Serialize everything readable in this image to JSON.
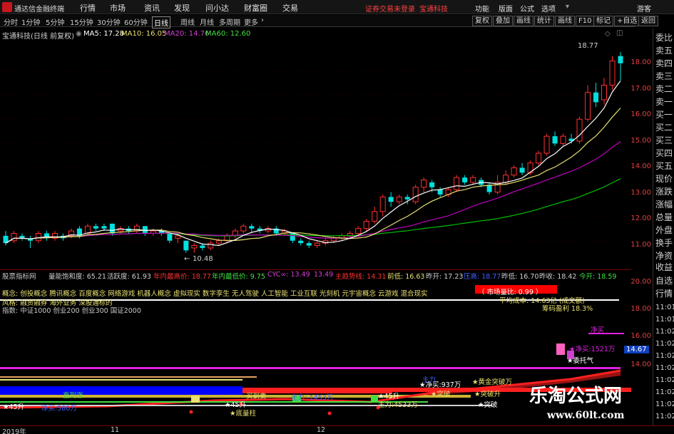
{
  "titlebar": {
    "app_title": "通达信金融终端",
    "menus": [
      "行情",
      "市场",
      "资讯",
      "发现",
      "问小达",
      "财富圈",
      "交易"
    ],
    "alert_login": "证券交易未登录",
    "alert_stock": "宝通科技",
    "right_menus": [
      "功能",
      "版面",
      "公式",
      "选项"
    ],
    "guest": "游客"
  },
  "periods": [
    "分时",
    "1分钟",
    "5分钟",
    "15分钟",
    "30分钟",
    "60分钟",
    "日线",
    "周线",
    "月线",
    "多周期",
    "更多"
  ],
  "active_period": "日线",
  "right_buttons": [
    "复权",
    "叠加",
    "画线",
    "统计",
    "画线",
    "F10",
    "标记",
    "+自选",
    "返回"
  ],
  "chart_header": {
    "stock": "宝通科技(日线 前复权)",
    "ma5": "MA5: 17.28",
    "ma10": "MA10: 16.05",
    "ma20": "MA20: 14.76",
    "ma60": "MA60: 12.60"
  },
  "price_axis": [
    "18.00",
    "17.00",
    "16.00",
    "15.00",
    "14.00",
    "13.00",
    "12.00",
    "11.00"
  ],
  "annotations": {
    "high": "18.77",
    "low": "10.48"
  },
  "right_panel": [
    "委比",
    "卖五",
    "卖四",
    "卖三",
    "卖二",
    "卖一",
    "买一",
    "买二",
    "买三",
    "买四",
    "买五",
    "现价",
    "涨跌",
    "涨幅",
    "总量",
    "外盘",
    "换手",
    "净资",
    "收益"
  ],
  "right_panel2": [
    "自选",
    "行情"
  ],
  "right_times": [
    "11:01",
    "11:01",
    "11:02",
    "11:02",
    "11:02",
    "11:02",
    "11:02",
    "11:02",
    "11:02",
    "11:02"
  ],
  "ind_bar": {
    "name": "股票指标网",
    "sat": "量能饱和度: 65.21",
    "act": "活跃度: 61.93",
    "yhigh": "年内最高价: 18.77",
    "ylow": "年内最低价: 9.75",
    "cyc": "CYC∞: 13.49",
    "v1": "13.49",
    "main": "主趋势线: 14.31",
    "prev_low": "前低: 16.63",
    "yest": "昨开: 17.23",
    "hl": "压高: 18.77",
    "ylow2": "昨低: 16.70",
    "yclose": "昨收: 18.42",
    "today": "今开: 18.59"
  },
  "concepts": "概念: 创投概念 腾讯概念 百度概念 网络游戏 机器人概念 虚拟现实 数字孪生 无人驾驶 人工智能 工业互联 光刻机 元宇宙概念 云游戏 混合现实",
  "board": "风格: 融资融券 海外业务 深股通标的",
  "index": "指数: 中证1000 创业200 创业300 国证2000",
  "lower_labels": {
    "red_box": "（ 市场量比: 0.99 ）",
    "cost": "平均成本: 14.63亿 (成交额)",
    "profit": "筹码盈利 18.3%",
    "axis": [
      "20.00",
      "18.00",
      "16.00",
      "14.00"
    ],
    "current": "14.67",
    "buy1": "净买",
    "buy2": "★净买:1521万",
    "mood": "★委托气",
    "l1": "★45升",
    "l2": "净买:580万",
    "l3": "直到涨",
    "l4": "买到卖",
    "l5": "主力:-1453万",
    "l6": "★45升",
    "l7": "主力:4533万",
    "l8": "★45升",
    "l9": "★底量柱",
    "l10": "★净买:937万",
    "l11": "★黄金突破万",
    "l12": "★突破",
    "l13": "★突破升",
    "l14": "★突破",
    "l15": "主力"
  },
  "dates": [
    "2019年",
    "11",
    "12"
  ],
  "watermark": {
    "name": "乐淘公式网",
    "url": "www.60lt.com"
  },
  "colors": {
    "up": "#ff3030",
    "down": "#00e0e0",
    "ma5": "#ffffff",
    "ma10": "#e8e070",
    "ma20": "#c000c0",
    "ma60": "#00c000"
  },
  "candles": [
    {
      "o": 11.2,
      "c": 10.9,
      "h": 11.4,
      "l": 10.8
    },
    {
      "o": 11.0,
      "c": 11.3,
      "h": 11.4,
      "l": 10.9
    },
    {
      "o": 11.2,
      "c": 11.1,
      "h": 11.3,
      "l": 11.0
    },
    {
      "o": 11.1,
      "c": 11.0,
      "h": 11.2,
      "l": 10.7
    },
    {
      "o": 11.0,
      "c": 11.3,
      "h": 11.4,
      "l": 10.9
    },
    {
      "o": 11.3,
      "c": 11.1,
      "h": 11.4,
      "l": 11.0
    },
    {
      "o": 11.1,
      "c": 11.3,
      "h": 11.4,
      "l": 11.0
    },
    {
      "o": 11.2,
      "c": 11.1,
      "h": 11.3,
      "l": 11.0
    },
    {
      "o": 11.2,
      "c": 11.4,
      "h": 11.5,
      "l": 11.1
    },
    {
      "o": 11.5,
      "c": 11.2,
      "h": 11.6,
      "l": 11.1
    },
    {
      "o": 11.3,
      "c": 11.6,
      "h": 11.7,
      "l": 11.2
    },
    {
      "o": 11.6,
      "c": 11.5,
      "h": 11.7,
      "l": 11.4
    },
    {
      "o": 11.6,
      "c": 11.5,
      "h": 11.7,
      "l": 11.4
    },
    {
      "o": 11.7,
      "c": 11.3,
      "h": 11.7,
      "l": 11.2
    },
    {
      "o": 11.4,
      "c": 11.5,
      "h": 11.6,
      "l": 11.3
    },
    {
      "o": 11.5,
      "c": 11.4,
      "h": 11.6,
      "l": 11.3
    },
    {
      "o": 11.4,
      "c": 11.6,
      "h": 11.7,
      "l": 11.3
    },
    {
      "o": 11.6,
      "c": 11.3,
      "h": 11.6,
      "l": 11.2
    },
    {
      "o": 11.3,
      "c": 11.4,
      "h": 11.5,
      "l": 11.2
    },
    {
      "o": 11.4,
      "c": 11.3,
      "h": 11.5,
      "l": 11.2
    },
    {
      "o": 11.3,
      "c": 11.0,
      "h": 11.3,
      "l": 10.9
    },
    {
      "o": 11.1,
      "c": 11.2,
      "h": 11.3,
      "l": 10.9
    },
    {
      "o": 11.0,
      "c": 10.6,
      "h": 11.0,
      "l": 10.5
    },
    {
      "o": 10.7,
      "c": 10.8,
      "h": 10.9,
      "l": 10.5
    },
    {
      "o": 10.8,
      "c": 10.7,
      "h": 10.9,
      "l": 10.6
    },
    {
      "o": 10.7,
      "c": 10.9,
      "h": 11.0,
      "l": 10.6
    },
    {
      "o": 10.9,
      "c": 11.0,
      "h": 11.1,
      "l": 10.8
    },
    {
      "o": 11.0,
      "c": 11.2,
      "h": 11.3,
      "l": 10.9
    },
    {
      "o": 11.2,
      "c": 11.4,
      "h": 11.5,
      "l": 11.1
    },
    {
      "o": 11.4,
      "c": 11.6,
      "h": 11.7,
      "l": 11.3
    },
    {
      "o": 11.6,
      "c": 11.5,
      "h": 11.7,
      "l": 11.3
    },
    {
      "o": 11.5,
      "c": 11.4,
      "h": 11.6,
      "l": 11.3
    },
    {
      "o": 11.4,
      "c": 11.5,
      "h": 11.6,
      "l": 11.3
    },
    {
      "o": 11.5,
      "c": 11.3,
      "h": 11.6,
      "l": 11.2
    },
    {
      "o": 11.3,
      "c": 11.4,
      "h": 11.5,
      "l": 11.2
    },
    {
      "o": 11.3,
      "c": 11.0,
      "h": 11.3,
      "l": 10.9
    },
    {
      "o": 11.0,
      "c": 10.9,
      "h": 11.1,
      "l": 10.8
    },
    {
      "o": 10.9,
      "c": 10.8,
      "h": 11.0,
      "l": 10.7
    },
    {
      "o": 10.8,
      "c": 10.9,
      "h": 11.0,
      "l": 10.7
    },
    {
      "o": 10.9,
      "c": 11.0,
      "h": 11.1,
      "l": 10.8
    },
    {
      "o": 11.0,
      "c": 11.1,
      "h": 11.2,
      "l": 10.9
    },
    {
      "o": 11.1,
      "c": 11.2,
      "h": 11.3,
      "l": 11.0
    },
    {
      "o": 11.2,
      "c": 11.3,
      "h": 11.4,
      "l": 11.1
    },
    {
      "o": 11.3,
      "c": 11.5,
      "h": 11.6,
      "l": 11.2
    },
    {
      "o": 11.5,
      "c": 11.8,
      "h": 11.9,
      "l": 11.4
    },
    {
      "o": 11.8,
      "c": 12.2,
      "h": 12.4,
      "l": 11.7
    },
    {
      "o": 12.2,
      "c": 12.8,
      "h": 12.9,
      "l": 12.0
    },
    {
      "o": 12.8,
      "c": 12.6,
      "h": 13.0,
      "l": 12.4
    },
    {
      "o": 12.6,
      "c": 12.8,
      "h": 12.9,
      "l": 12.5
    },
    {
      "o": 12.8,
      "c": 12.7,
      "h": 12.9,
      "l": 12.5
    },
    {
      "o": 12.6,
      "c": 13.2,
      "h": 13.3,
      "l": 12.5
    },
    {
      "o": 13.2,
      "c": 13.5,
      "h": 13.6,
      "l": 13.0
    },
    {
      "o": 13.4,
      "c": 13.2,
      "h": 13.5,
      "l": 13.0
    },
    {
      "o": 13.1,
      "c": 12.9,
      "h": 13.2,
      "l": 12.8
    },
    {
      "o": 12.9,
      "c": 13.1,
      "h": 13.2,
      "l": 12.8
    },
    {
      "o": 13.1,
      "c": 13.6,
      "h": 13.7,
      "l": 13.0
    },
    {
      "o": 13.6,
      "c": 13.4,
      "h": 13.7,
      "l": 13.3
    },
    {
      "o": 13.4,
      "c": 13.6,
      "h": 13.7,
      "l": 13.3
    },
    {
      "o": 13.5,
      "c": 13.3,
      "h": 13.6,
      "l": 13.2
    },
    {
      "o": 13.3,
      "c": 13.0,
      "h": 13.4,
      "l": 12.9
    },
    {
      "o": 13.0,
      "c": 13.4,
      "h": 13.7,
      "l": 12.9
    },
    {
      "o": 13.4,
      "c": 13.7,
      "h": 13.9,
      "l": 13.3
    },
    {
      "o": 13.7,
      "c": 14.0,
      "h": 14.1,
      "l": 13.6
    },
    {
      "o": 14.0,
      "c": 13.8,
      "h": 14.2,
      "l": 13.7
    },
    {
      "o": 13.8,
      "c": 14.2,
      "h": 14.3,
      "l": 13.7
    },
    {
      "o": 14.2,
      "c": 14.6,
      "h": 14.7,
      "l": 14.1
    },
    {
      "o": 14.6,
      "c": 15.3,
      "h": 15.4,
      "l": 14.5
    },
    {
      "o": 15.3,
      "c": 15.0,
      "h": 15.5,
      "l": 14.9
    },
    {
      "o": 15.0,
      "c": 15.3,
      "h": 15.4,
      "l": 14.9
    },
    {
      "o": 15.2,
      "c": 15.1,
      "h": 15.4,
      "l": 15.0
    },
    {
      "o": 15.1,
      "c": 16.0,
      "h": 16.1,
      "l": 15.0
    },
    {
      "o": 16.0,
      "c": 17.1,
      "h": 17.4,
      "l": 15.9
    },
    {
      "o": 17.1,
      "c": 16.7,
      "h": 17.5,
      "l": 16.5
    },
    {
      "o": 16.8,
      "c": 17.4,
      "h": 17.7,
      "l": 16.6
    },
    {
      "o": 17.4,
      "c": 18.4,
      "h": 18.6,
      "l": 17.2
    },
    {
      "o": 18.6,
      "c": 18.3,
      "h": 18.77,
      "l": 17.6
    }
  ]
}
